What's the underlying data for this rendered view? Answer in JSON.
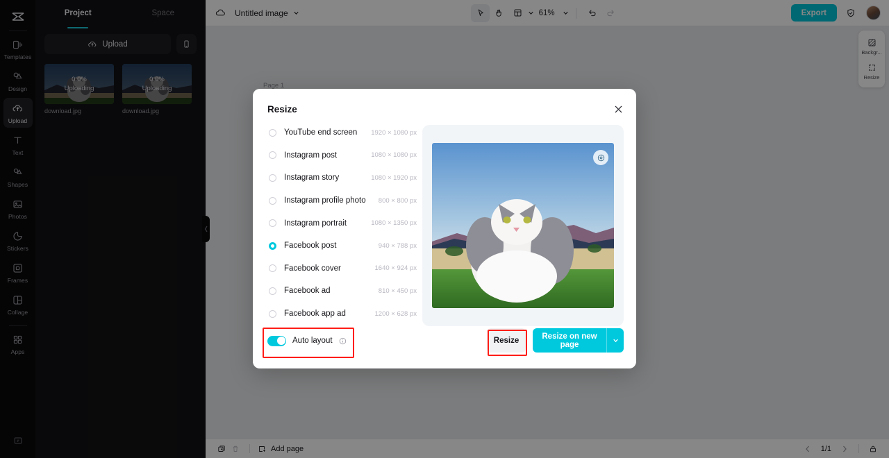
{
  "rail": {
    "logo_icon": "capcut-logo-icon",
    "items": [
      {
        "label": "Templates",
        "icon": "templates-icon",
        "active": false
      },
      {
        "label": "Design",
        "icon": "design-icon",
        "active": false
      },
      {
        "label": "Upload",
        "icon": "upload-cloud-icon",
        "active": true
      },
      {
        "label": "Text",
        "icon": "text-t-icon",
        "active": false
      },
      {
        "label": "Shapes",
        "icon": "shapes-icon",
        "active": false
      },
      {
        "label": "Photos",
        "icon": "photos-icon",
        "active": false
      },
      {
        "label": "Stickers",
        "icon": "stickers-icon",
        "active": false
      },
      {
        "label": "Frames",
        "icon": "frames-icon",
        "active": false
      },
      {
        "label": "Collage",
        "icon": "collage-icon",
        "active": false
      },
      {
        "label": "Apps",
        "icon": "apps-grid-icon",
        "active": false
      }
    ],
    "bottom_icon": "help-icon"
  },
  "panel": {
    "tabs": [
      {
        "label": "Project",
        "active": true
      },
      {
        "label": "Space",
        "active": false
      }
    ],
    "upload_button": "Upload",
    "upload_icon": "upload-cloud-icon",
    "mobile_icon": "mobile-phone-icon",
    "uploads": [
      {
        "progress": "0.0%",
        "status": "Uploading",
        "filename": "download.jpg"
      },
      {
        "progress": "0.0%",
        "status": "Uploading",
        "filename": "download.jpg"
      }
    ]
  },
  "topbar": {
    "cloud_icon": "cloud-save-icon",
    "doc_title": "Untitled image",
    "title_caret_icon": "chevron-down-icon",
    "select_tool_icon": "cursor-select-icon",
    "hand_tool_icon": "hand-pan-icon",
    "layout_tool_icon": "layout-grid-icon",
    "layout_caret_icon": "chevron-down-icon",
    "zoom_level": "61%",
    "zoom_caret_icon": "chevron-down-icon",
    "undo_icon": "undo-icon",
    "redo_icon": "redo-icon",
    "export_label": "Export",
    "shield_icon": "shield-check-icon",
    "avatar_icon": "user-avatar"
  },
  "canvas": {
    "page_label": "Page 1"
  },
  "right_tools": [
    {
      "label": "Backgr...",
      "icon": "background-checker-icon"
    },
    {
      "label": "Resize",
      "icon": "resize-frame-icon"
    }
  ],
  "bottombar": {
    "duplicate_icon": "duplicate-page-icon",
    "delete_icon": "trash-icon",
    "add_page_icon": "add-page-icon",
    "add_page_label": "Add page",
    "prev_icon": "chevron-left-icon",
    "page_indicator": "1/1",
    "next_icon": "chevron-right-icon",
    "lock_icon": "lock-icon"
  },
  "modal": {
    "title": "Resize",
    "close_icon": "close-x-icon",
    "options": [
      {
        "label": "YouTube end screen",
        "dimensions": "1920 × 1080 px",
        "selected": false
      },
      {
        "label": "Instagram post",
        "dimensions": "1080 × 1080 px",
        "selected": false
      },
      {
        "label": "Instagram story",
        "dimensions": "1080 × 1920 px",
        "selected": false
      },
      {
        "label": "Instagram profile photo",
        "dimensions": "800 × 800 px",
        "selected": false
      },
      {
        "label": "Instagram portrait",
        "dimensions": "1080 × 1350 px",
        "selected": false
      },
      {
        "label": "Facebook post",
        "dimensions": "940 × 788 px",
        "selected": true
      },
      {
        "label": "Facebook cover",
        "dimensions": "1640 × 924 px",
        "selected": false
      },
      {
        "label": "Facebook ad",
        "dimensions": "810 × 450 px",
        "selected": false
      },
      {
        "label": "Facebook app ad",
        "dimensions": "1200 × 628 px",
        "selected": false
      }
    ],
    "preview": {
      "crop_badge_icon": "smart-crop-icon"
    },
    "auto_layout_label": "Auto layout",
    "auto_layout_info_icon": "info-circle-icon",
    "auto_layout_on": true,
    "resize_label": "Resize",
    "resize_new_page_label": "Resize on new page",
    "resize_new_page_caret_icon": "chevron-down-icon"
  },
  "colors": {
    "accent": "#00c9de",
    "annotation": "#ff1d17",
    "rail_bg": "#0b0b0d",
    "panel_bg": "#121215",
    "canvas_bg": "#e9eaed"
  }
}
